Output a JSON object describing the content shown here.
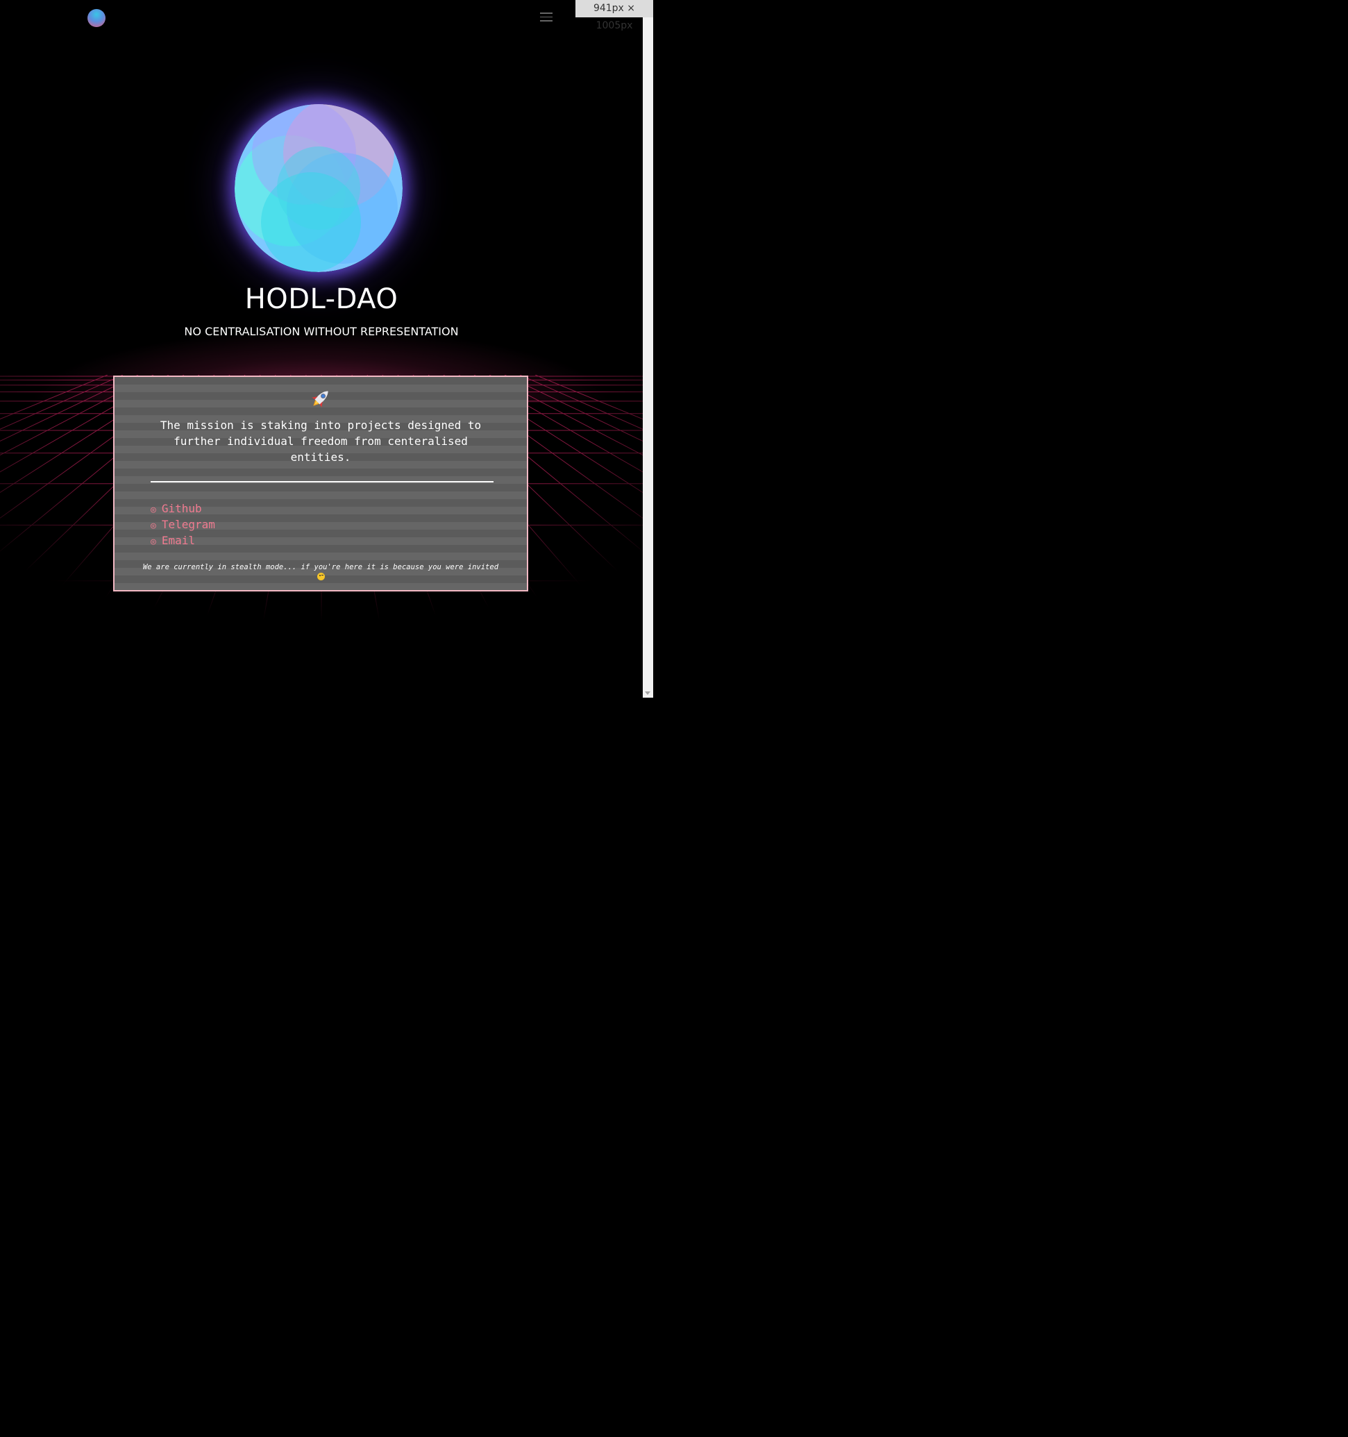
{
  "browser": {
    "size_tooltip": "941px × 1005px"
  },
  "nav": {
    "logo_icon": "orb-logo-icon",
    "menu_icon": "hamburger-menu-icon"
  },
  "hero": {
    "title": "HODL-DAO",
    "subtitle": "NO CENTRALISATION WITHOUT REPRESENTATION",
    "orb_colors": [
      "#63f2e6",
      "#62b4ff",
      "#a59cff",
      "#f39ac7"
    ]
  },
  "card": {
    "icon": "rocket-icon",
    "mission": "The mission is staking into projects designed to further individual freedom from centeralised entities.",
    "links": [
      {
        "label": "Github",
        "bullet": "◎"
      },
      {
        "label": "Telegram",
        "bullet": "◎"
      },
      {
        "label": "Email",
        "bullet": "◎"
      }
    ],
    "stealth_note": "We are currently in stealth mode... if you're here it is because you were invited",
    "stealth_icon": "wink-emoji-icon"
  },
  "colors": {
    "background": "#000000",
    "card_border": "#f3b9c4",
    "link": "#f07b90",
    "grid": "#ff2d7a",
    "orb_glow": "#7a5cff"
  }
}
